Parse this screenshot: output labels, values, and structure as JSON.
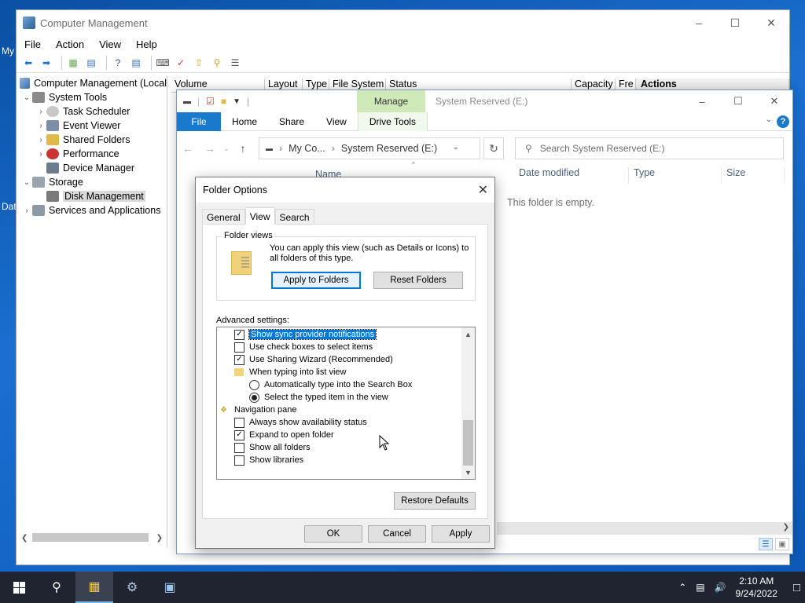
{
  "desktop": {
    "label_top": "My",
    "label_bottom": "Dat"
  },
  "computer_management": {
    "title": "Computer Management",
    "menu": [
      "File",
      "Action",
      "View",
      "Help"
    ],
    "tree": [
      {
        "label": "Computer Management (Local",
        "indent": 0
      },
      {
        "label": "System Tools",
        "indent": 1
      },
      {
        "label": "Task Scheduler",
        "indent": 2
      },
      {
        "label": "Event Viewer",
        "indent": 2
      },
      {
        "label": "Shared Folders",
        "indent": 2
      },
      {
        "label": "Performance",
        "indent": 2
      },
      {
        "label": "Device Manager",
        "indent": 2
      },
      {
        "label": "Storage",
        "indent": 1
      },
      {
        "label": "Disk Management",
        "indent": 2
      },
      {
        "label": "Services and Applications",
        "indent": 1
      }
    ],
    "columns": [
      "Volume",
      "Layout",
      "Type",
      "File System",
      "Status",
      "Capacity",
      "Fre"
    ],
    "actions_header": "Actions",
    "bottom_value": "0"
  },
  "explorer": {
    "manage_tab": "Manage",
    "title": "System Reserved (E:)",
    "ribbon_tabs": {
      "file": "File",
      "home": "Home",
      "share": "Share",
      "view": "View",
      "drive_tools": "Drive Tools"
    },
    "address": {
      "part1": "My Co...",
      "part2": "System Reserved (E:)"
    },
    "search_placeholder": "Search System Reserved (E:)",
    "columns": {
      "name": "Name",
      "date_modified": "Date modified",
      "type": "Type",
      "size": "Size"
    },
    "empty_message": "This folder is empty."
  },
  "folder_options": {
    "title": "Folder Options",
    "tabs": [
      "General",
      "View",
      "Search"
    ],
    "active_tab": "View",
    "folder_views": {
      "legend": "Folder views",
      "description": "You can apply this view (such as Details or Icons) to all folders of this type.",
      "apply_button": "Apply to Folders",
      "reset_button": "Reset Folders"
    },
    "advanced_label": "Advanced settings:",
    "advanced_items": [
      {
        "label": "Show sync provider notifications",
        "kind": "checkbox",
        "checked": true,
        "selected": true
      },
      {
        "label": "Use check boxes to select items",
        "kind": "checkbox",
        "checked": false
      },
      {
        "label": "Use Sharing Wizard (Recommended)",
        "kind": "checkbox",
        "checked": true
      },
      {
        "label": "When typing into list view",
        "kind": "folder"
      },
      {
        "label": "Automatically type into the Search Box",
        "kind": "radio",
        "checked": false
      },
      {
        "label": "Select the typed item in the view",
        "kind": "radio",
        "checked": true
      },
      {
        "label": "Navigation pane",
        "kind": "group"
      },
      {
        "label": "Always show availability status",
        "kind": "checkbox",
        "checked": false
      },
      {
        "label": "Expand to open folder",
        "kind": "checkbox",
        "checked": true
      },
      {
        "label": "Show all folders",
        "kind": "checkbox",
        "checked": false
      },
      {
        "label": "Show libraries",
        "kind": "checkbox",
        "checked": false
      }
    ],
    "restore_defaults": "Restore Defaults",
    "ok": "OK",
    "cancel": "Cancel",
    "apply": "Apply"
  },
  "taskbar": {
    "time": "2:10 AM",
    "date": "9/24/2022"
  }
}
